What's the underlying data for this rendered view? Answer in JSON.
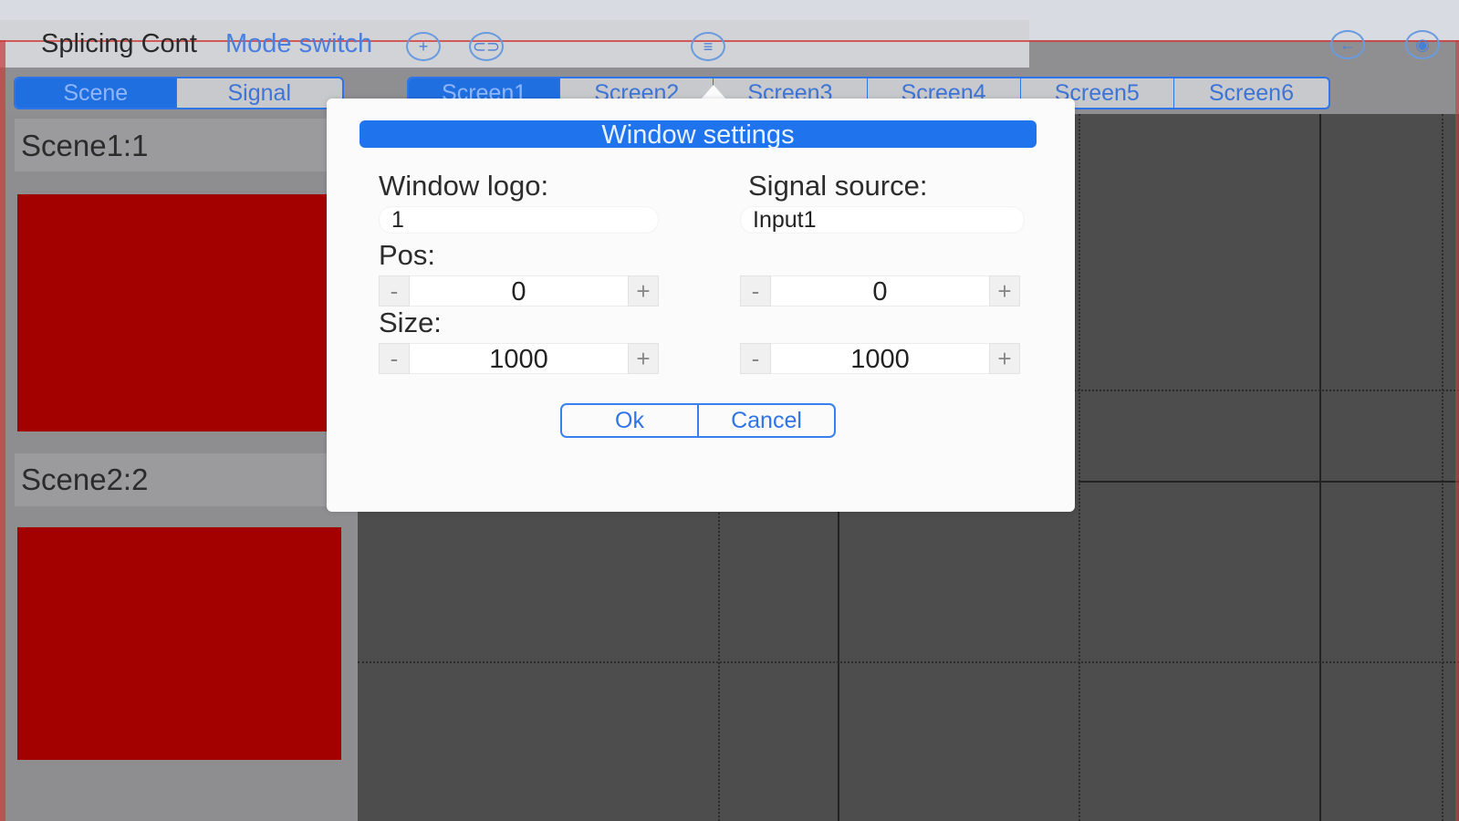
{
  "header": {
    "title": "Splicing Cont",
    "mode_switch": "Mode switch",
    "icons": [
      "add-circle-icon",
      "link-icon",
      "menu-icon",
      "back-icon",
      "eye-icon"
    ]
  },
  "side_tabs": [
    "Scene",
    "Signal"
  ],
  "screen_tabs": [
    "Screen1",
    "Screen2",
    "Screen3",
    "Screen4",
    "Screen5",
    "Screen6"
  ],
  "scenes": [
    {
      "label": "Scene1:1"
    },
    {
      "label": "Scene2:2"
    }
  ],
  "dialog": {
    "title": "Window settings",
    "window_logo_label": "Window logo:",
    "window_logo_value": "1",
    "signal_source_label": "Signal source:",
    "signal_source_value": "Input1",
    "pos_label": "Pos:",
    "pos_x": "0",
    "pos_y": "0",
    "size_label": "Size:",
    "size_w": "1000",
    "size_h": "1000",
    "minus": "-",
    "plus": "+",
    "ok": "Ok",
    "cancel": "Cancel"
  },
  "colors": {
    "accent": "#1f74ee",
    "scene_thumb": "#a30000",
    "canvas": "#4d4d4d"
  }
}
